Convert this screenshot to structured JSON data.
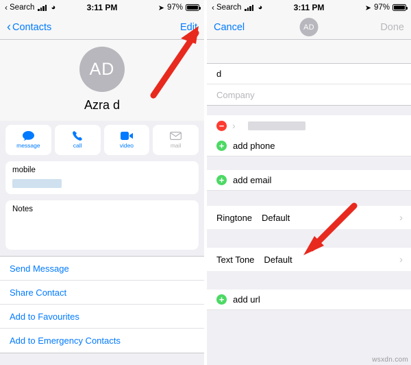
{
  "left": {
    "statusbar": {
      "search_label": "Search",
      "time": "3:11 PM",
      "battery": "97%"
    },
    "nav": {
      "back_label": "Contacts",
      "edit_label": "Edit"
    },
    "contact": {
      "initials": "AD",
      "name": "Azra d"
    },
    "actions": [
      {
        "label": "message",
        "icon": "message-bubble-icon"
      },
      {
        "label": "call",
        "icon": "phone-icon"
      },
      {
        "label": "video",
        "icon": "video-camera-icon"
      },
      {
        "label": "mail",
        "icon": "envelope-icon"
      }
    ],
    "phone_card": {
      "label": "mobile",
      "value": ""
    },
    "notes_card": {
      "label": "Notes"
    },
    "links": [
      "Send Message",
      "Share Contact",
      "Add to Favourites",
      "Add to Emergency Contacts"
    ]
  },
  "right": {
    "statusbar": {
      "search_label": "Search",
      "time": "3:11 PM",
      "battery": "97%"
    },
    "nav": {
      "cancel_label": "Cancel",
      "initials": "AD",
      "done_label": "Done"
    },
    "name_fields": [
      {
        "value": "d",
        "placeholder": ""
      },
      {
        "value": "",
        "placeholder": "Company"
      }
    ],
    "phone_row": {
      "delete_icon": "minus-circle-icon",
      "chevron": "chevron-right-icon"
    },
    "add_phone_label": "add phone",
    "add_email_label": "add email",
    "ringtone": {
      "key": "Ringtone",
      "value": "Default"
    },
    "text_tone": {
      "key": "Text Tone",
      "value": "Default"
    },
    "add_url_label": "add url"
  },
  "watermark": "wsxdn.com",
  "colors": {
    "accent": "#007aff",
    "arrow": "#e8291e",
    "green": "#4cd964",
    "red": "#ff3b30"
  }
}
